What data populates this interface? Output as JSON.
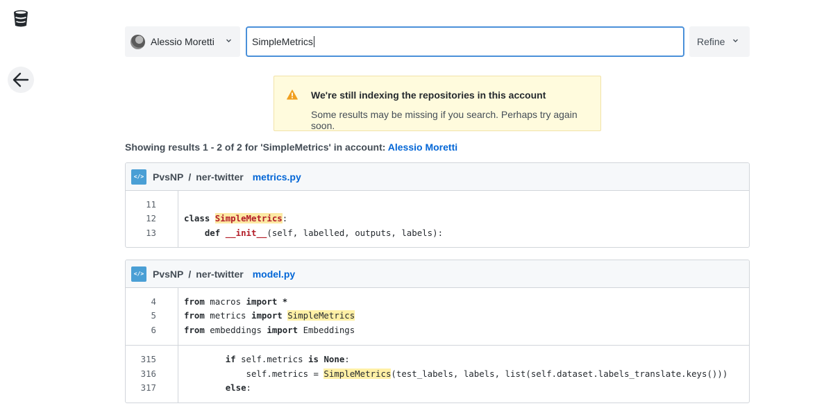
{
  "header": {
    "account_name": "Alessio Moretti",
    "search_value": "SimpleMetrics",
    "refine_label": "Refine"
  },
  "notice": {
    "title": "We're still indexing the repositories in this account",
    "message": "Some results may be missing if you search. Perhaps try again soon."
  },
  "summary": {
    "prefix": "Showing results 1 - 2 of 2 for 'SimpleMetrics' in account: ",
    "account": "Alessio Moretti"
  },
  "results": [
    {
      "owner": "PvsNP",
      "separator": "/",
      "repo": "ner-twitter",
      "file": "metrics.py",
      "hunks": [
        {
          "lines": [
            {
              "no": "11",
              "segments": []
            },
            {
              "no": "12",
              "segments": [
                {
                  "t": "class",
                  "c": "kw"
                },
                {
                  "t": " "
                },
                {
                  "t": "SimpleMetrics",
                  "c": "hl-strong"
                },
                {
                  "t": ":"
                }
              ]
            },
            {
              "no": "13",
              "segments": [
                {
                  "t": "    "
                },
                {
                  "t": "def",
                  "c": "kw"
                },
                {
                  "t": " "
                },
                {
                  "t": "__init__",
                  "c": "fn"
                },
                {
                  "t": "(self, labelled, outputs, labels):"
                }
              ]
            }
          ]
        }
      ]
    },
    {
      "owner": "PvsNP",
      "separator": "/",
      "repo": "ner-twitter",
      "file": "model.py",
      "hunks": [
        {
          "lines": [
            {
              "no": "4",
              "segments": [
                {
                  "t": "from",
                  "c": "kw"
                },
                {
                  "t": " macros "
                },
                {
                  "t": "import",
                  "c": "kw"
                },
                {
                  "t": " "
                },
                {
                  "t": "*",
                  "c": "kw"
                }
              ]
            },
            {
              "no": "5",
              "segments": [
                {
                  "t": "from",
                  "c": "kw"
                },
                {
                  "t": " metrics "
                },
                {
                  "t": "import",
                  "c": "kw"
                },
                {
                  "t": " "
                },
                {
                  "t": "SimpleMetrics",
                  "c": "hl"
                }
              ]
            },
            {
              "no": "6",
              "segments": [
                {
                  "t": "from",
                  "c": "kw"
                },
                {
                  "t": " embeddings "
                },
                {
                  "t": "import",
                  "c": "kw"
                },
                {
                  "t": " Embeddings"
                }
              ]
            }
          ]
        },
        {
          "lines": [
            {
              "no": "315",
              "segments": [
                {
                  "t": "        "
                },
                {
                  "t": "if",
                  "c": "kw"
                },
                {
                  "t": " self.metrics "
                },
                {
                  "t": "is",
                  "c": "kw"
                },
                {
                  "t": " "
                },
                {
                  "t": "None",
                  "c": "kw"
                },
                {
                  "t": ":"
                }
              ]
            },
            {
              "no": "316",
              "segments": [
                {
                  "t": "            self.metrics = "
                },
                {
                  "t": "SimpleMetrics",
                  "c": "hl"
                },
                {
                  "t": "(test_labels, labels, list(self.dataset.labels_translate.keys()))"
                }
              ]
            },
            {
              "no": "317",
              "segments": [
                {
                  "t": "        "
                },
                {
                  "t": "else",
                  "c": "kw"
                },
                {
                  "t": ":"
                }
              ]
            }
          ]
        }
      ]
    }
  ],
  "colors": {
    "accent_link": "#0366d6",
    "search_border": "#4a90d9",
    "warning_bg": "#fffbdd",
    "warning_icon": "#f0a020",
    "match_highlight": "#fff0a6"
  },
  "icons": {
    "logo": "bucket-logo-icon",
    "back": "arrow-left-icon",
    "dropdown": "chevron-down-icon",
    "warning": "warning-triangle-icon",
    "file_type": "code-file-icon"
  }
}
